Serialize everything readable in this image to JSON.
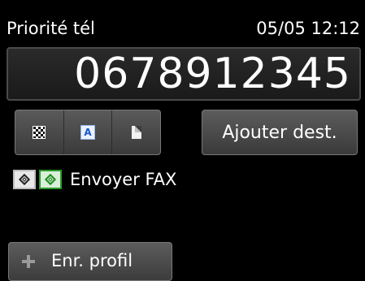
{
  "header": {
    "mode": "Priorité tél",
    "datetime": "05/05 12:12"
  },
  "number_display": {
    "value": "0678912345"
  },
  "settings_buttons": [
    {
      "icon": "resolution-checker-icon"
    },
    {
      "icon": "text-mode-a-icon"
    },
    {
      "icon": "document-page-icon"
    }
  ],
  "add_destination": {
    "label": "Ajouter dest."
  },
  "send": {
    "label": "Envoyer FAX",
    "icons": [
      "start-mono-icon",
      "start-color-icon"
    ]
  },
  "profile": {
    "label": "Enr. profil",
    "icon": "plus-icon"
  }
}
